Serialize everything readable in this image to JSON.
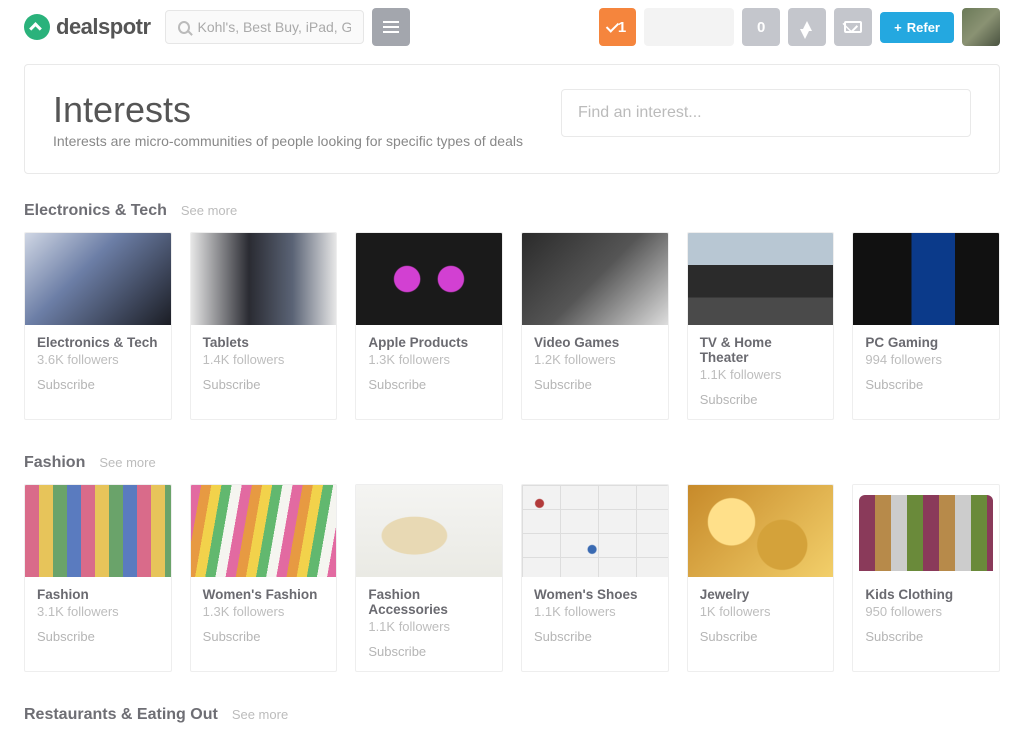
{
  "header": {
    "brand": "dealspotr",
    "search_placeholder": "Kohl's, Best Buy, iPad, Gifts for Mom",
    "notif_count": "1",
    "points": "0",
    "refer_label": "Refer"
  },
  "intro": {
    "title": "Interests",
    "subtitle": "Interests are micro-communities of people looking for specific types of deals",
    "find_placeholder": "Find an interest..."
  },
  "labels": {
    "see_more": "See more",
    "subscribe": "Subscribe"
  },
  "sections": [
    {
      "title": "Electronics & Tech",
      "cards": [
        {
          "name": "Electronics & Tech",
          "followers": "3.6K followers"
        },
        {
          "name": "Tablets",
          "followers": "1.4K followers"
        },
        {
          "name": "Apple Products",
          "followers": "1.3K followers"
        },
        {
          "name": "Video Games",
          "followers": "1.2K followers"
        },
        {
          "name": "TV & Home Theater",
          "followers": "1.1K followers"
        },
        {
          "name": "PC Gaming",
          "followers": "994 followers"
        }
      ]
    },
    {
      "title": "Fashion",
      "cards": [
        {
          "name": "Fashion",
          "followers": "3.1K followers"
        },
        {
          "name": "Women's Fashion",
          "followers": "1.3K followers"
        },
        {
          "name": "Fashion Accessories",
          "followers": "1.1K followers"
        },
        {
          "name": "Women's Shoes",
          "followers": "1.1K followers"
        },
        {
          "name": "Jewelry",
          "followers": "1K followers"
        },
        {
          "name": "Kids Clothing",
          "followers": "950 followers"
        }
      ]
    },
    {
      "title": "Restaurants & Eating Out",
      "cards": []
    }
  ]
}
